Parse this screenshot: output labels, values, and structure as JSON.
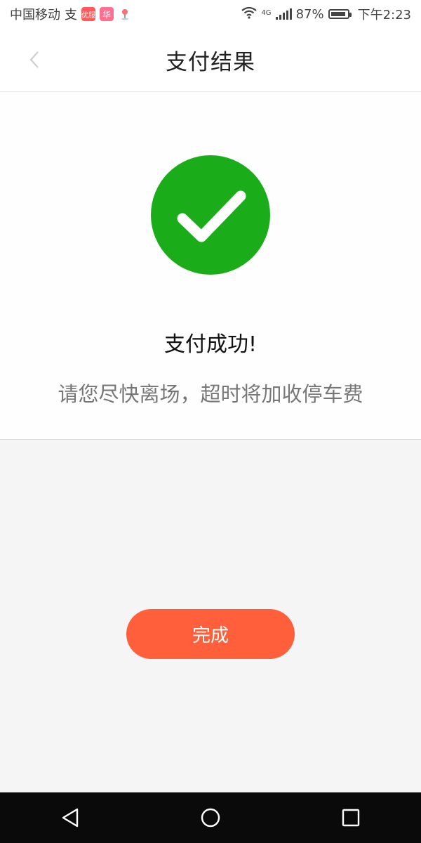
{
  "status_bar": {
    "carrier": "中国移动",
    "icon_zhi": "支",
    "icon_app1": "优服",
    "icon_app2": "华",
    "network": "4G",
    "battery": "87%",
    "time": "下午2:23"
  },
  "navbar": {
    "title": "支付结果",
    "back_icon": "chevron-left-icon"
  },
  "result": {
    "icon": "check-circle-icon",
    "icon_color": "#1aad19",
    "title": "支付成功!",
    "subtitle": "请您尽快离场，超时将加收停车费"
  },
  "actions": {
    "done_label": "完成",
    "done_color": "#ff5f3b"
  },
  "system_nav": {
    "back": "triangle-back-icon",
    "home": "circle-home-icon",
    "recents": "square-recents-icon"
  }
}
